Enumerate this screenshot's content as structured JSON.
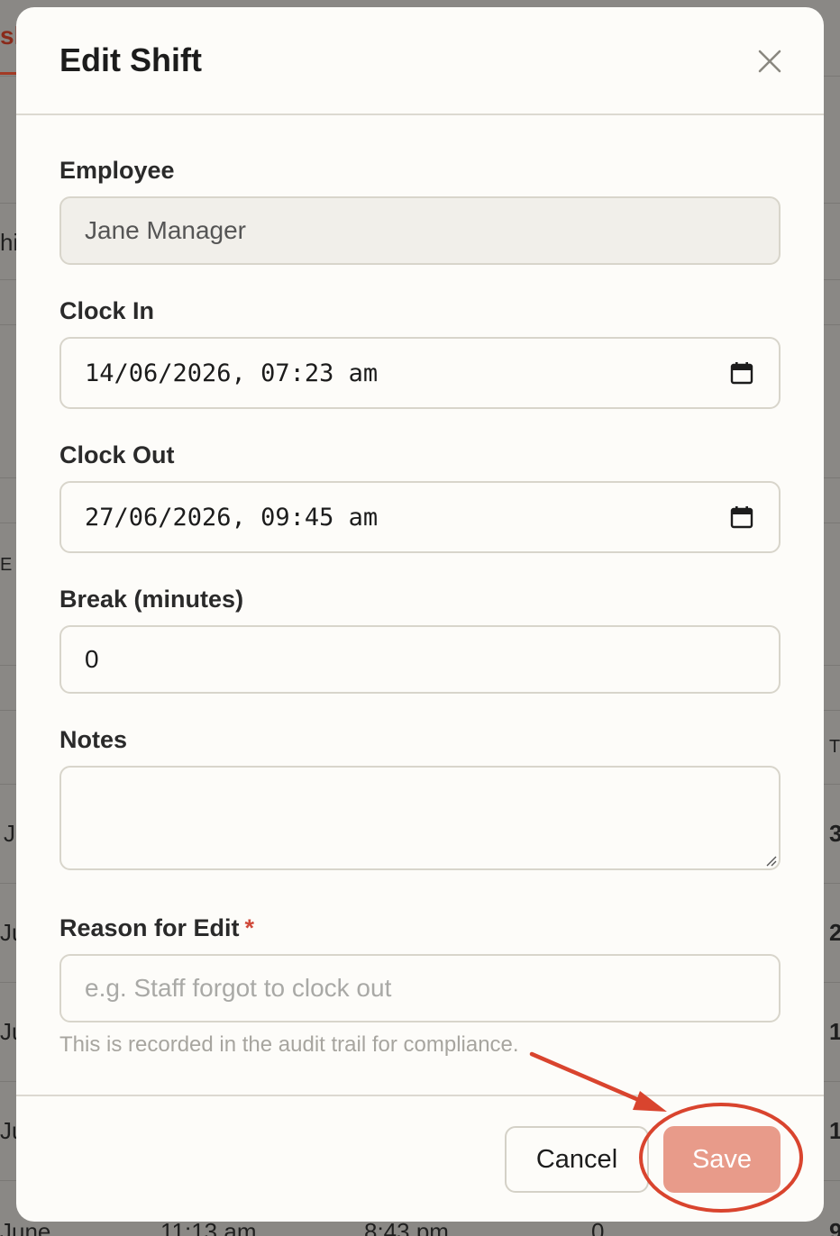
{
  "background": {
    "tab_label": "sh",
    "row_snippets": [
      "hi",
      "E C",
      "J",
      "Ju",
      "Ju",
      "Ju",
      "June",
      "11:13 am",
      "8:43 pm",
      "0"
    ],
    "right_snippets": [
      "T",
      "3",
      "2",
      "1",
      "1",
      "9"
    ]
  },
  "modal": {
    "title": "Edit Shift",
    "close_icon": "close-icon",
    "fields": {
      "employee": {
        "label": "Employee",
        "value": "Jane Manager"
      },
      "clock_in": {
        "label": "Clock In",
        "value": "14/06/2026, 07:23 am"
      },
      "clock_out": {
        "label": "Clock Out",
        "value": "27/06/2026, 09:45 am"
      },
      "break": {
        "label": "Break (minutes)",
        "value": "0"
      },
      "notes": {
        "label": "Notes",
        "value": ""
      },
      "reason": {
        "label": "Reason for Edit",
        "required_mark": "*",
        "placeholder": "e.g. Staff forgot to clock out",
        "helper": "This is recorded in the audit trail for compliance."
      }
    },
    "footer": {
      "cancel_label": "Cancel",
      "save_label": "Save"
    }
  },
  "colors": {
    "accent": "#d0493a",
    "save_bg": "#e89b8a",
    "annotation": "#d9442e"
  }
}
